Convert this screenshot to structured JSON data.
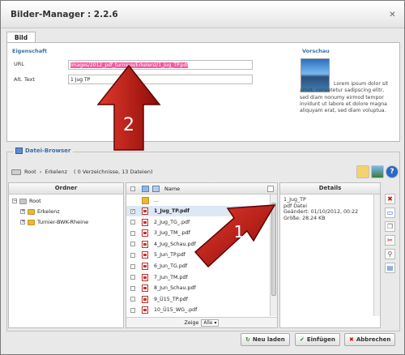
{
  "window": {
    "title": "Bilder-Manager : 2.2.6",
    "close_glyph": "✕"
  },
  "tabs": [
    {
      "label": "Bild"
    }
  ],
  "properties": {
    "heading": "Eigenschaft",
    "url_label": "URL",
    "url_value": "Images/2012_pdf_turniere/Erkelenz/1_Jug_TP.pdf",
    "alt_label": "Alt. Text",
    "alt_value": "1 Jug TP"
  },
  "preview": {
    "heading": "Vorschau",
    "text": "Lorem ipsum dolor sit amet, consetetur sadipscing elitr, sed diam nonumy eirmod tempor invidunt ut labore et dolore magna aliquyam erat, sed diam voluptua."
  },
  "browser": {
    "heading": "Datei-Browser",
    "breadcrumb_root": "Root",
    "breadcrumb_sep": "›",
    "breadcrumb_folder": "Erkelenz",
    "breadcrumb_info": "( 0 Verzeichnisse, 13 Dateien)"
  },
  "tree": {
    "header": "Ordner",
    "items": [
      {
        "label": "Root",
        "expander": "−",
        "color": "grey"
      },
      {
        "label": "Erkelenz",
        "expander": "+",
        "color": "yellow"
      },
      {
        "label": "Turnier-BWK-Rheine",
        "expander": "+",
        "color": "yellow"
      }
    ]
  },
  "files": {
    "header_name": "Name",
    "up_label": "...",
    "items": [
      {
        "name": "1_Jug_TP.pdf",
        "selected": true
      },
      {
        "name": "2_Jug_TG_.pdf",
        "selected": false
      },
      {
        "name": "3_Jug_TM_.pdf",
        "selected": false
      },
      {
        "name": "4_Jug_Schau.pdf",
        "selected": false
      },
      {
        "name": "5_Jun_TP.pdf",
        "selected": false
      },
      {
        "name": "6_Jun_TG.pdf",
        "selected": false
      },
      {
        "name": "7_Jun_TM.pdf",
        "selected": false
      },
      {
        "name": "8_Jun_Schau.pdf",
        "selected": false
      },
      {
        "name": "9_Ü15_TP.pdf",
        "selected": false
      },
      {
        "name": "10_Ü15_WG_.pdf",
        "selected": false
      }
    ],
    "footer_label": "Zeige",
    "footer_select": "Alle"
  },
  "details": {
    "header": "Details",
    "name": "1_Jug_TP",
    "type": "pdf Datei",
    "changed": "Geändert: 01/10/2012, 00:22",
    "size": "Größe: 28.24 KB"
  },
  "buttons": {
    "reload": "Neu laden",
    "insert": "Einfügen",
    "cancel": "Abbrechen"
  },
  "annotations": {
    "arrow1_label": "1",
    "arrow2_label": "2",
    "arrow_color": "#c0140f"
  }
}
